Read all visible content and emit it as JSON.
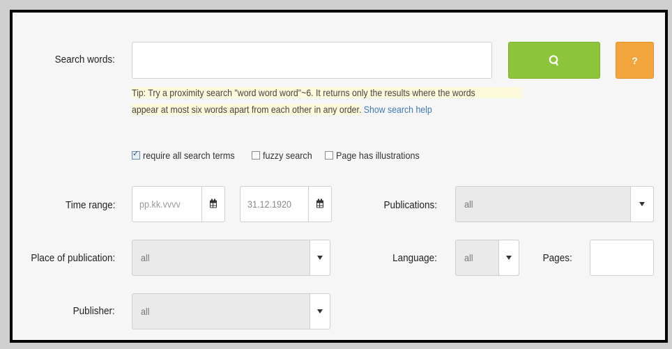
{
  "labels": {
    "search_words": "Search words:",
    "time_range": "Time range:",
    "publications": "Publications:",
    "place_of_publication": "Place of publication:",
    "language": "Language:",
    "pages": "Pages:",
    "publisher": "Publisher:"
  },
  "search": {
    "value": "",
    "placeholder": ""
  },
  "buttons": {
    "search_icon": "search-icon",
    "help_label": "?"
  },
  "tip": {
    "text_line1": "Tip: Try a proximity search \"word word word\"~6. It returns only the results where the words",
    "text_line2": "appear at most six words apart from each other in any order.",
    "link": "Show search help"
  },
  "options": [
    {
      "label": "require all search terms",
      "checked": true
    },
    {
      "label": "fuzzy search",
      "checked": false
    },
    {
      "label": "Page has illustrations",
      "checked": false
    }
  ],
  "time_range": {
    "start_placeholder": "pp.kk.vvvv",
    "end_value": "31.12.1920"
  },
  "selects": {
    "publications": "all",
    "place_of_publication": "all",
    "language": "all",
    "publisher": "all"
  },
  "pages": {
    "value": ""
  },
  "colors": {
    "search_button": "#8cc43a",
    "help_button": "#f2a43d",
    "link": "#3f79b8",
    "tip_highlight": "#fdfadc"
  }
}
